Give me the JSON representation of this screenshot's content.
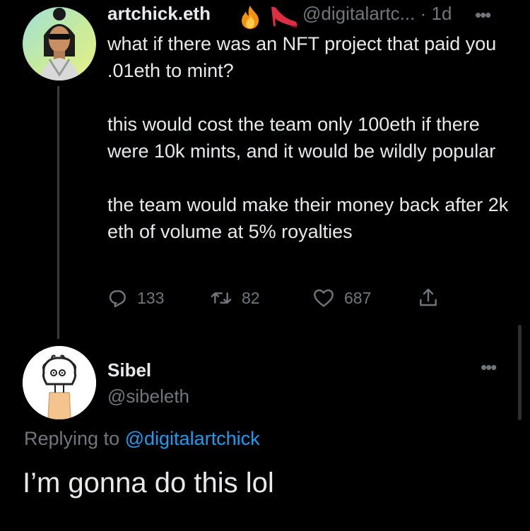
{
  "tweet": {
    "author_name": "artchick.eth",
    "emoji_icons": [
      "fire-emoji",
      "high-heel-emoji"
    ],
    "handle": "@digitalartc...",
    "separator": "·",
    "time": "1d",
    "body_lines": [
      "what if there was an NFT project that paid you .01eth to mint?",
      "this would cost the team only 100eth if there were 10k mints, and it would be wildly popular",
      "the team would make their money back after 2k eth of volume at 5% royalties"
    ],
    "actions": {
      "replies": "133",
      "retweets": "82",
      "likes": "687"
    }
  },
  "reply": {
    "author_name": "Sibel",
    "handle": "@sibeleth",
    "replying_prefix": "Replying to",
    "replying_to": "@digitalartchick",
    "body": "I’m gonna do this lol"
  },
  "colors": {
    "background": "#000000",
    "text_primary": "#e7e9ea",
    "text_secondary": "#71767b",
    "link_blue": "#1d9bf0"
  }
}
